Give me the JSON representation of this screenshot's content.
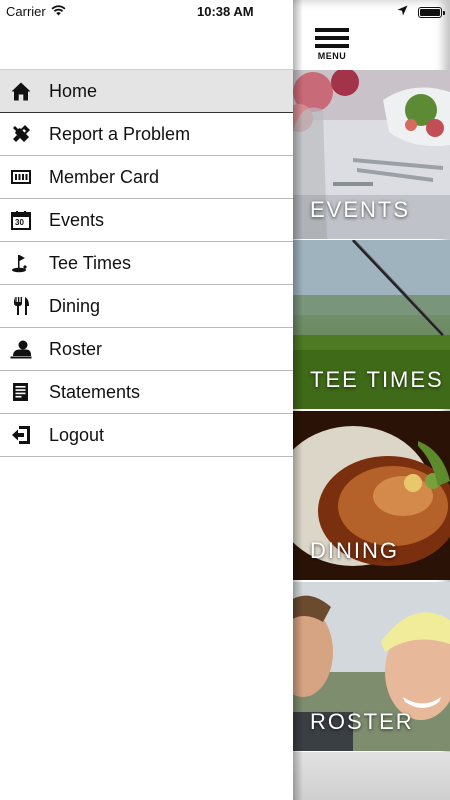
{
  "status_bar": {
    "carrier": "Carrier",
    "time": "10:38 AM"
  },
  "drawer": {
    "items": [
      {
        "label": "Home",
        "icon": "home-icon",
        "active": true
      },
      {
        "label": "Report a Problem",
        "icon": "tools-icon"
      },
      {
        "label": "Member Card",
        "icon": "card-icon"
      },
      {
        "label": "Events",
        "icon": "calendar-icon"
      },
      {
        "label": "Tee Times",
        "icon": "golf-flag-icon"
      },
      {
        "label": "Dining",
        "icon": "fork-knife-icon"
      },
      {
        "label": "Roster",
        "icon": "person-icon"
      },
      {
        "label": "Statements",
        "icon": "document-icon"
      },
      {
        "label": "Logout",
        "icon": "logout-icon"
      }
    ],
    "calendar_day": "30"
  },
  "header": {
    "menu_label": "MENU"
  },
  "tiles": {
    "events": "EVENTS",
    "tee_times": "TEE TIMES",
    "dining": "DINING",
    "roster": "ROSTER"
  }
}
